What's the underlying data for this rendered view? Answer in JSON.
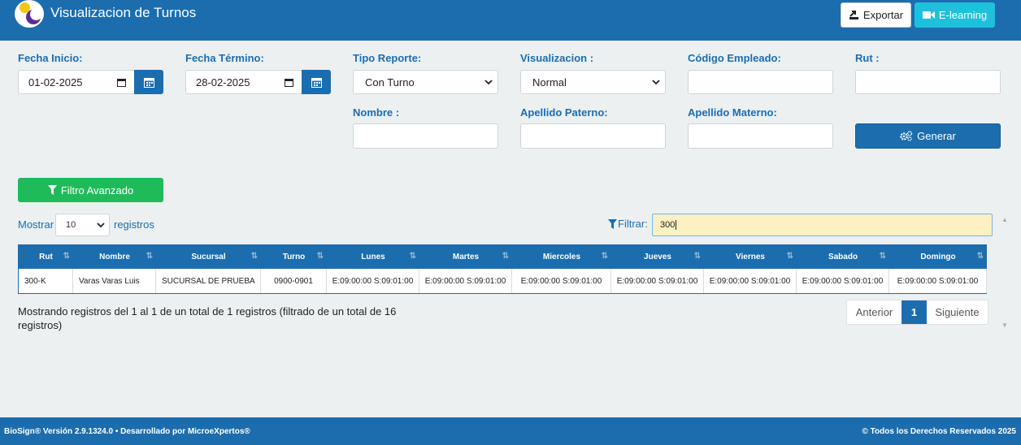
{
  "header": {
    "title": "Visualizacion de Turnos",
    "export_label": "Exportar",
    "elearning_label": "E-learning"
  },
  "form": {
    "fecha_inicio": {
      "label": "Fecha Inicio:",
      "value": "01-02-2025"
    },
    "fecha_termino": {
      "label": "Fecha Término:",
      "value": "28-02-2025"
    },
    "tipo_reporte": {
      "label": "Tipo Reporte:",
      "value": "Con Turno"
    },
    "visualizacion": {
      "label": "Visualizacion :",
      "value": "Normal"
    },
    "codigo_empleado": {
      "label": "Código Empleado:",
      "value": ""
    },
    "rut": {
      "label": "Rut :",
      "value": ""
    },
    "nombre": {
      "label": "Nombre :",
      "value": ""
    },
    "apellido_paterno": {
      "label": "Apellido Paterno:",
      "value": ""
    },
    "apellido_materno": {
      "label": "Apellido Materno:",
      "value": ""
    },
    "generar_label": "Generar",
    "filtro_avanzado_label": "Filtro Avanzado"
  },
  "table_controls": {
    "mostrar_label": "Mostrar",
    "page_length": "10",
    "registros_label": "registros",
    "filtrar_label": "Filtrar:",
    "filtrar_value": "300"
  },
  "table": {
    "columns": [
      "Rut",
      "Nombre",
      "Sucursal",
      "Turno",
      "Lunes",
      "Martes",
      "Miercoles",
      "Jueves",
      "Viernes",
      "Sabado",
      "Domingo"
    ],
    "rows": [
      [
        "300-K",
        "Varas Varas Luis",
        "SUCURSAL DE PRUEBA",
        "0900-0901",
        "E:09:00:00 S:09:01:00",
        "E:09:00:00 S:09:01:00",
        "E:09:00:00 S:09:01:00",
        "E:09:00:00 S:09:01:00",
        "E:09:00:00 S:09:01:00",
        "E:09:00:00 S:09:01:00",
        "E:09:00:00 S:09:01:00"
      ]
    ]
  },
  "info_text": "Mostrando registros del 1 al 1 de un total de 1 registros (filtrado de un total de 16 registros)",
  "pager": {
    "prev": "Anterior",
    "current": "1",
    "next": "Siguiente"
  },
  "footer": {
    "left": "BioSign® Versión 2.9.1324.0 • Desarrollado por MicroeXpertos®",
    "right": "© Todos los Derechos Reservados 2025"
  }
}
